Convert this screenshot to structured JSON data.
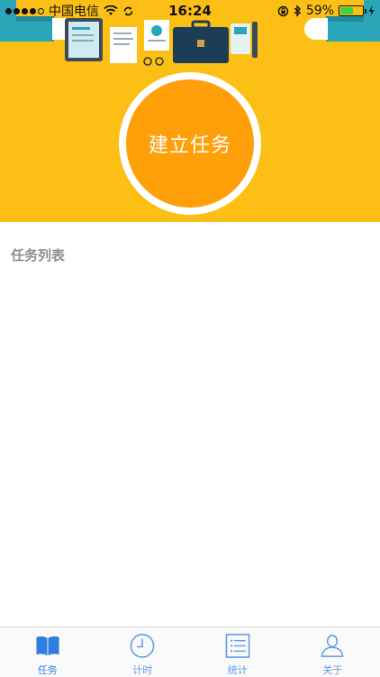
{
  "status_bar": {
    "carrier": "中国电信",
    "time": "16:24",
    "battery_percent": "59%",
    "battery_level": 0.59,
    "icons": [
      "signal-dots",
      "wifi-icon",
      "sync-icon",
      "orientation-lock-icon",
      "bluetooth-icon",
      "battery-icon",
      "charging-icon"
    ]
  },
  "banner": {
    "background_color": "#fcbf16",
    "create_button_label": "建立任务",
    "button_color": "#ff9f0a"
  },
  "task_section": {
    "title": "任务列表",
    "items": []
  },
  "tab_bar": {
    "accent_color": "#2d7ee0",
    "tabs": [
      {
        "label": "任务",
        "icon": "book-icon",
        "active": true
      },
      {
        "label": "计时",
        "icon": "clock-icon",
        "active": false
      },
      {
        "label": "统计",
        "icon": "list-icon",
        "active": false
      },
      {
        "label": "关于",
        "icon": "person-icon",
        "active": false
      }
    ]
  }
}
